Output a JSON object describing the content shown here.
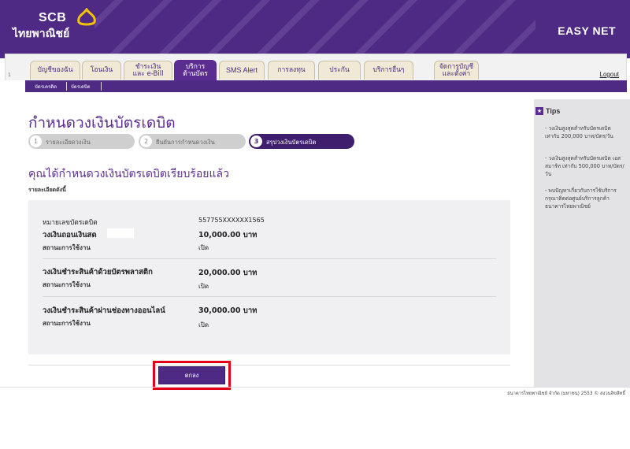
{
  "header": {
    "logo_en": "SCB",
    "logo_th": "ไทยพาณิชย์",
    "product": "EASY NET"
  },
  "menu": {
    "tabs": [
      {
        "label": "บัญชีของฉัน"
      },
      {
        "label": "โอนเงิน"
      },
      {
        "label": "ชำระเงิน\nและ e-Bill"
      },
      {
        "label": "บริการ\nด้านบัตร"
      },
      {
        "label": "SMS Alert"
      },
      {
        "label": "การลงทุน"
      },
      {
        "label": "ประกัน"
      },
      {
        "label": "บริการอื่นๆ"
      },
      {
        "label": "จัดการบัญชี\nและตั้งค่า"
      }
    ],
    "logout": "Logout"
  },
  "submenu": {
    "items": [
      "บัตรเครดิต",
      "บัตรเดบิต"
    ]
  },
  "page": {
    "title": "กำหนดวงเงินบัตรเดบิต",
    "steps": [
      {
        "num": "1",
        "label": "รายละเอียดวงเงิน"
      },
      {
        "num": "2",
        "label": "ยืนยันการกำหนดวงเงิน"
      },
      {
        "num": "3",
        "label": "สรุปวงเงินบัตรเดบิต"
      }
    ],
    "success": "คุณได้กำหนดวงเงินบัตรเดบิตเรียบร้อยแล้ว",
    "details_label": "รายละเอียดดังนี้",
    "card_number_label": "หมายเลขบัตรเดบิต",
    "card_number": "557755XXXXXX1565",
    "cash_limit_label": "วงเงินถอนเงินสด",
    "cash_limit": "10,000.00 บาท",
    "status_label": "สถานะการใช้งาน",
    "status_value": "เปิด",
    "plastic_label": "วงเงินชำระสินค้าด้วยบัตรพลาสติก",
    "plastic_limit": "20,000.00 บาท",
    "online_label": "วงเงินชำระสินค้าผ่านช่องทางออนไลน์",
    "online_limit": "30,000.00 บาท",
    "ok_button": "ตกลง"
  },
  "sidebar": {
    "title": "Tips",
    "tips": [
      "- วงเงินสูงสุดสำหรับบัตรเดบิต เท่ากับ 200,000 บาท/บัตร/วัน",
      "- วงเงินสูงสุดสำหรับบัตรเดบิต เอส สมาร์ท เท่ากับ 500,000 บาท/บัตร/วัน",
      "- พบปัญหาเกี่ยวกับการใช้บริการ กรุณาติดต่อศูนย์บริการลูกค้า ธนาคารไทยพาณิชย์"
    ]
  },
  "footer": {
    "copyright": "ธนาคารไทยพาณิชย์ จำกัด (มหาชน) 2553 © สงวนลิขสิทธิ์"
  },
  "colors": {
    "brand_purple": "#4e2a84",
    "highlight_red": "#e3001b"
  }
}
